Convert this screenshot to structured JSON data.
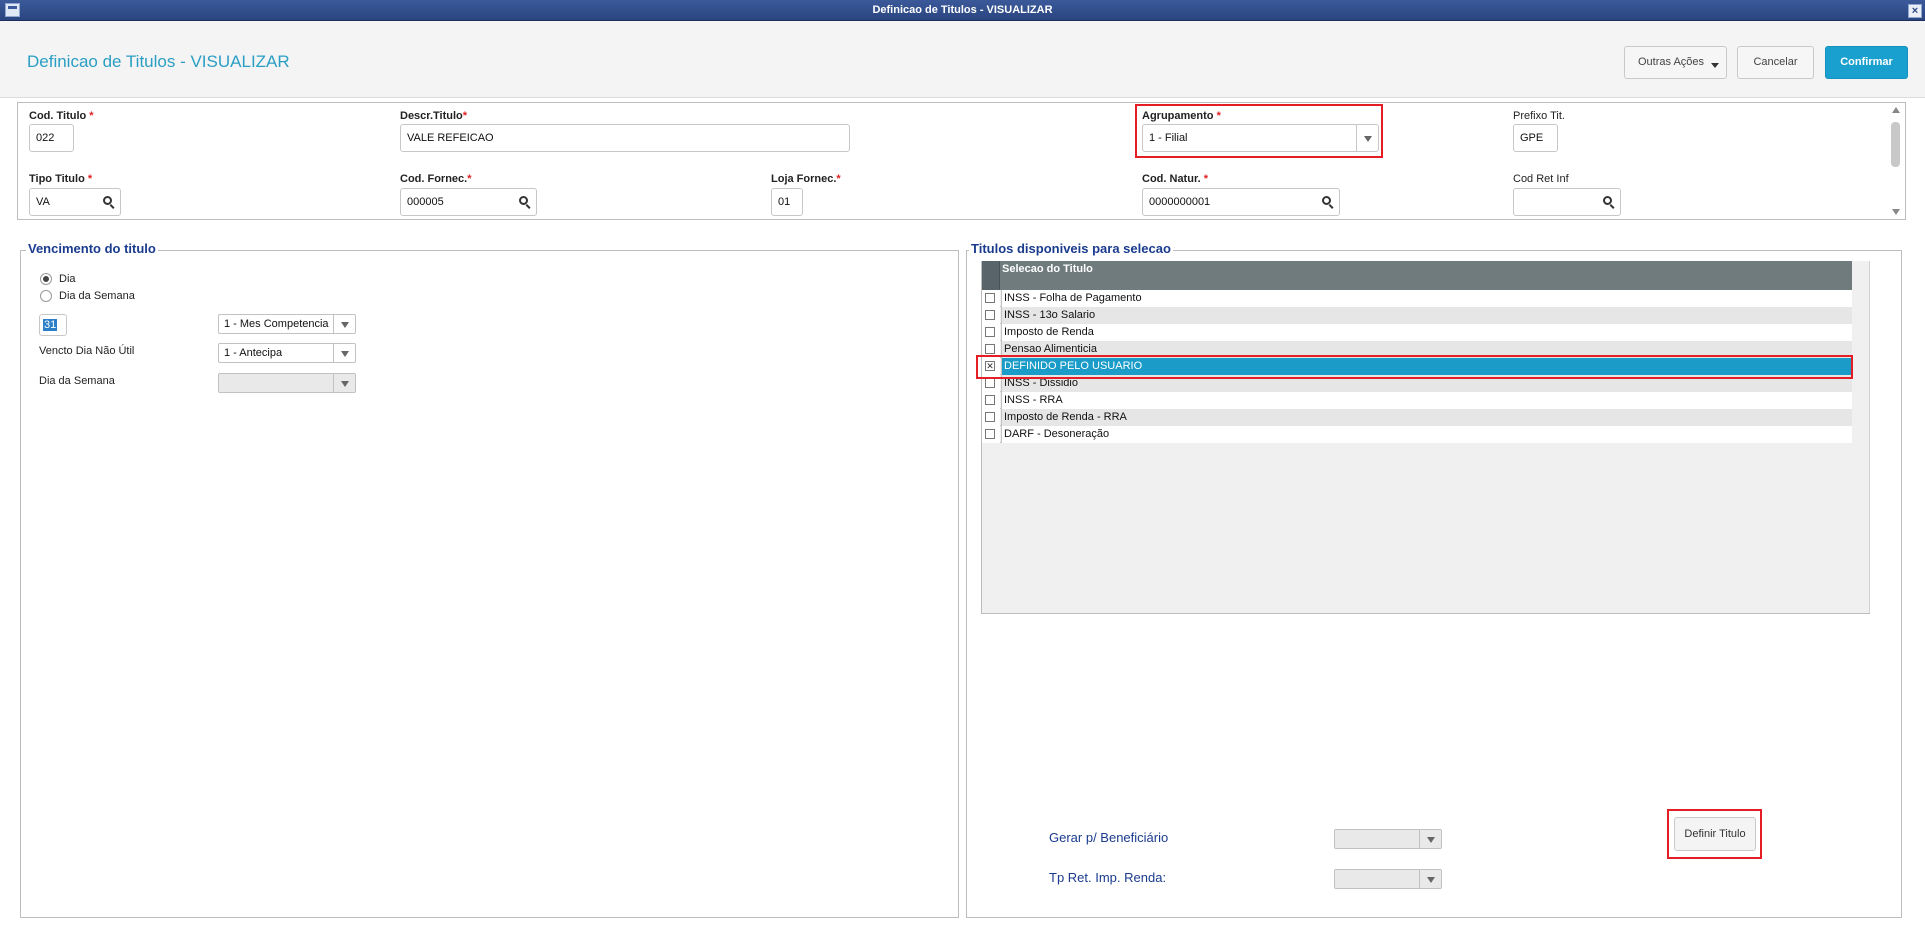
{
  "window": {
    "title": "Definicao de Titulos - VISUALIZAR",
    "close_glyph": "×"
  },
  "header": {
    "page_title": "Definicao de Titulos - VISUALIZAR",
    "btn_outras": "Outras Ações",
    "btn_cancelar": "Cancelar",
    "btn_confirmar": "Confirmar"
  },
  "form": {
    "cod_titulo": {
      "label": "Cod. Titulo",
      "required": "*",
      "value": "022"
    },
    "descr_titulo": {
      "label": "Descr.Titulo",
      "required": "*",
      "value": "VALE REFEICAO"
    },
    "agrupamento": {
      "label": "Agrupamento",
      "required": "*",
      "value": "1 - Filial"
    },
    "prefixo_tit": {
      "label": "Prefixo Tit.",
      "value": "GPE"
    },
    "tipo_titulo": {
      "label": "Tipo Titulo",
      "required": "*",
      "value": "VA"
    },
    "cod_fornec": {
      "label": "Cod. Fornec.",
      "required": "*",
      "value": "000005"
    },
    "loja_fornec": {
      "label": "Loja Fornec.",
      "required": "*",
      "value": "01"
    },
    "cod_natur": {
      "label": "Cod. Natur.",
      "required": "*",
      "value": "0000000001"
    },
    "cod_ret_inf": {
      "label": "Cod Ret Inf",
      "value": ""
    }
  },
  "vencimento": {
    "legend": "Vencimento do titulo",
    "radio_dia": "Dia",
    "radio_dia_semana": "Dia da Semana",
    "day_value": "31",
    "competencia_value": "1 - Mes Competencia",
    "vencto_label": "Vencto Dia Não Útil",
    "vencto_value": "1 - Antecipa",
    "dia_semana_label": "Dia da Semana",
    "dia_semana_value": ""
  },
  "titulos": {
    "legend": "Titulos disponiveis para selecao",
    "column_header": "Selecao do Titulo",
    "rows": [
      {
        "label": "INSS - Folha de Pagamento",
        "checked": ""
      },
      {
        "label": "INSS - 13o Salario",
        "checked": ""
      },
      {
        "label": "Imposto de Renda",
        "checked": ""
      },
      {
        "label": "Pensao Alimenticia",
        "checked": ""
      },
      {
        "label": "DEFINIDO PELO USUARIO",
        "checked": "✕"
      },
      {
        "label": "INSS - Dissidio",
        "checked": ""
      },
      {
        "label": "INSS - RRA",
        "checked": ""
      },
      {
        "label": "Imposto de Renda - RRA",
        "checked": ""
      },
      {
        "label": "DARF - Desoneração",
        "checked": ""
      }
    ],
    "gerar_label": "Gerar p/ Beneficiário",
    "tp_ret_label": "Tp Ret. Imp. Renda:",
    "btn_definir": "Definir Titulo"
  },
  "colors": {
    "accent": "#1aa0cf",
    "selected_row": "#1a9bc8",
    "highlight_box": "#e51d24",
    "legend_text": "#1a3b8e"
  }
}
